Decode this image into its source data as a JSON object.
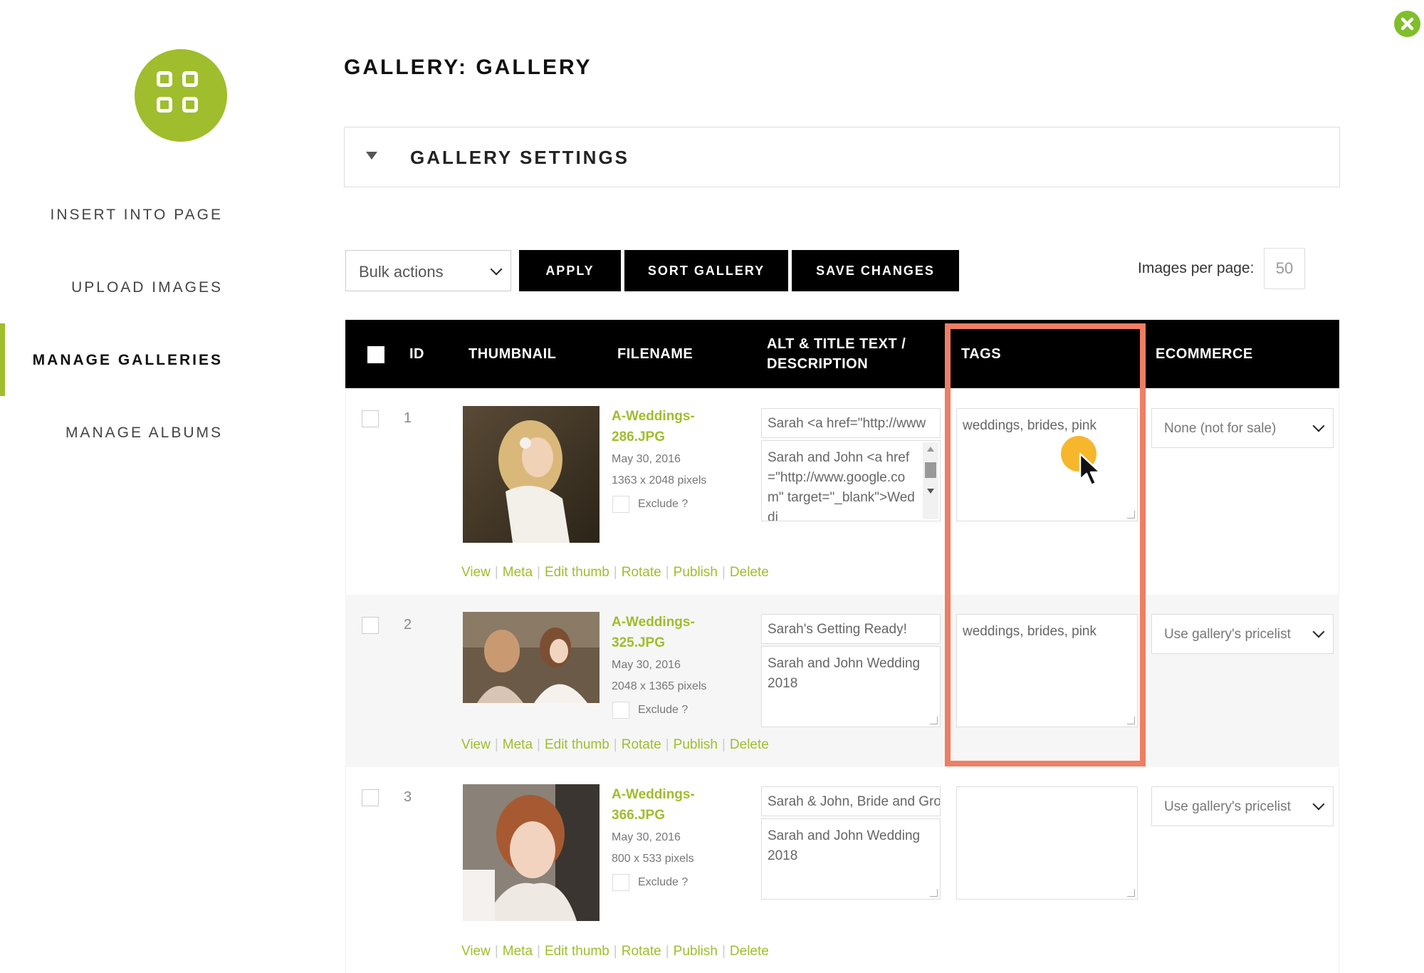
{
  "sidebar": {
    "items": [
      {
        "label": "INSERT INTO PAGE"
      },
      {
        "label": "UPLOAD IMAGES"
      },
      {
        "label": "MANAGE GALLERIES"
      },
      {
        "label": "MANAGE ALBUMS"
      }
    ],
    "active_index": 2,
    "accent_color": "#9fbd2c"
  },
  "header": {
    "title": "GALLERY: GALLERY",
    "settings_label": "GALLERY SETTINGS"
  },
  "toolbar": {
    "bulk_actions": "Bulk actions",
    "apply_label": "APPLY",
    "sort_label": "SORT GALLERY",
    "save_label": "SAVE CHANGES",
    "images_per_page_label": "Images per page:",
    "images_per_page_value": "50"
  },
  "table": {
    "columns": {
      "id": "ID",
      "thumbnail": "THUMBNAIL",
      "filename": "FILENAME",
      "alt_line1": "ALT & TITLE TEXT /",
      "alt_line2": "DESCRIPTION",
      "tags": "TAGS",
      "ecommerce": "ECOMMERCE"
    },
    "rows": [
      {
        "id": "1",
        "filename_line1": "A-Weddings-",
        "filename_line2": "286.JPG",
        "date": "May 30, 2016",
        "dimensions": "1363 x 2048 pixels",
        "exclude_label": "Exclude ?",
        "alt_title": "Sarah <a href=\"http://www",
        "description": "Sarah and John <a href=\"http://www.google.com\" target=\"_blank\">Weddi",
        "tags": "weddings, brides, pink",
        "ecommerce": "None (not for sale)"
      },
      {
        "id": "2",
        "filename_line1": "A-Weddings-",
        "filename_line2": "325.JPG",
        "date": "May 30, 2016",
        "dimensions": "2048 x 1365 pixels",
        "exclude_label": "Exclude ?",
        "alt_title": "Sarah's Getting Ready!",
        "description": "Sarah and John Wedding 2018",
        "tags": "weddings, brides, pink",
        "ecommerce": "Use gallery's pricelist"
      },
      {
        "id": "3",
        "filename_line1": "A-Weddings-",
        "filename_line2": "366.JPG",
        "date": "May 30, 2016",
        "dimensions": "800 x 533 pixels",
        "exclude_label": "Exclude ?",
        "alt_title": "Sarah & John, Bride and Gro",
        "description": "Sarah and John Wedding 2018",
        "tags": "",
        "ecommerce": "Use gallery's pricelist"
      }
    ],
    "actions": {
      "view": "View",
      "meta": "Meta",
      "edit_thumb": "Edit thumb",
      "rotate": "Rotate",
      "publish": "Publish",
      "delete": "Delete"
    }
  },
  "highlight_color": "#ef7e63"
}
